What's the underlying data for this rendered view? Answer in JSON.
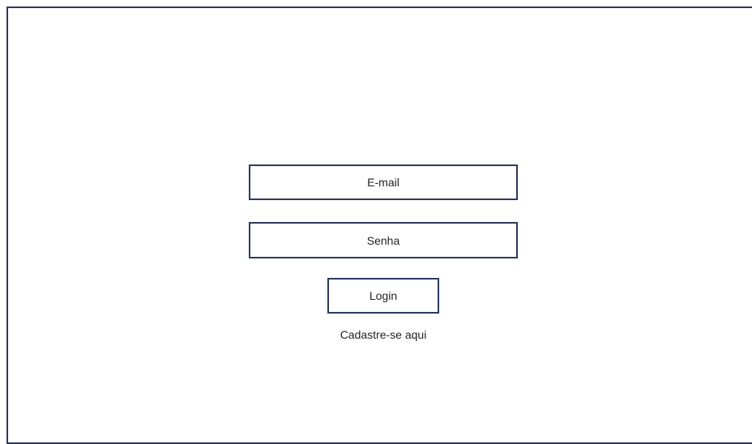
{
  "login_form": {
    "email_placeholder": "E-mail",
    "password_placeholder": "Senha",
    "login_label": "Login",
    "signup_link_label": "Cadastre-se aqui"
  },
  "colors": {
    "border": "#2c3a5c",
    "background": "#ffffff",
    "text": "#222222"
  }
}
